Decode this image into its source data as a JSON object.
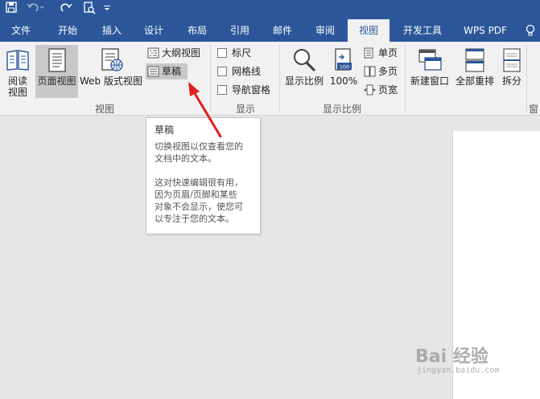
{
  "quick_access": {
    "save_icon": "save-icon",
    "undo_icon": "undo-icon",
    "redo_icon": "redo-icon",
    "preview_icon": "print-preview-icon",
    "customize_icon": "customize-qat-icon"
  },
  "tabs": [
    {
      "label": "文件"
    },
    {
      "label": "开始"
    },
    {
      "label": "插入"
    },
    {
      "label": "设计"
    },
    {
      "label": "布局"
    },
    {
      "label": "引用"
    },
    {
      "label": "邮件"
    },
    {
      "label": "审阅"
    },
    {
      "label": "视图",
      "active": true
    },
    {
      "label": "开发工具"
    },
    {
      "label": "WPS PDF"
    }
  ],
  "ribbon": {
    "views": {
      "reading": "阅读\n视图",
      "page": "页面视图",
      "web": "Web 版式视图",
      "outline": "大纲视图",
      "draft": "草稿",
      "group_label": "视图"
    },
    "show": {
      "ruler": "标尺",
      "gridlines": "网格线",
      "nav_pane": "导航窗格",
      "group_label": "显示"
    },
    "zoom": {
      "zoom": "显示比例",
      "zoom100": "100%",
      "one_page": "单页",
      "multi_page": "多页",
      "page_width": "页宽",
      "group_label": "显示比例"
    },
    "window": {
      "new_window": "新建窗口",
      "arrange_all": "全部重排",
      "split": "拆分",
      "group_label_partial": "窗"
    }
  },
  "tooltip": {
    "title": "草稿",
    "body": "切换视图以仅查看您的\n文档中的文本。\n\n这对快速编辑很有用，\n因为页眉/页脚和某些\n对象不会显示，使您可\n以专注于您的文本。"
  },
  "watermark": {
    "brand": "Bai 经验",
    "url": "jingyan.baidu.com"
  },
  "colors": {
    "accent": "#2b579a",
    "ribbon_bg": "#f1f1f1",
    "arrow": "#e02020"
  }
}
